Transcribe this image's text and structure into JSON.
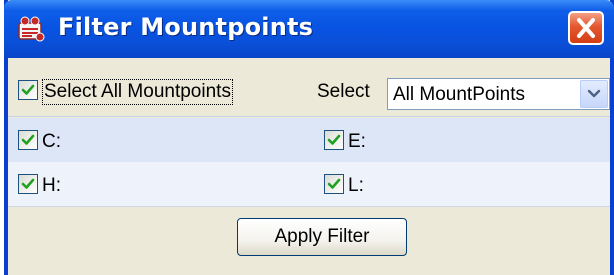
{
  "window": {
    "title": "Filter Mountpoints",
    "icon": "app-logo-icon",
    "close_icon": "close-icon"
  },
  "select_all": {
    "label": "Select All Mountpoints",
    "checked": true
  },
  "select_dropdown": {
    "label": "Select",
    "value": "All MountPoints"
  },
  "mountpoints": [
    {
      "label": "C:",
      "checked": true
    },
    {
      "label": "E:",
      "checked": true
    },
    {
      "label": "H:",
      "checked": true
    },
    {
      "label": "L:",
      "checked": true
    }
  ],
  "apply_button": {
    "label": "Apply Filter"
  },
  "colors": {
    "title_bar": "#0a4fd8",
    "close_button": "#d43d14",
    "checkmark": "#21a121",
    "dialog_bg": "#ece9d8",
    "row_highlight": "#dce6f6"
  }
}
